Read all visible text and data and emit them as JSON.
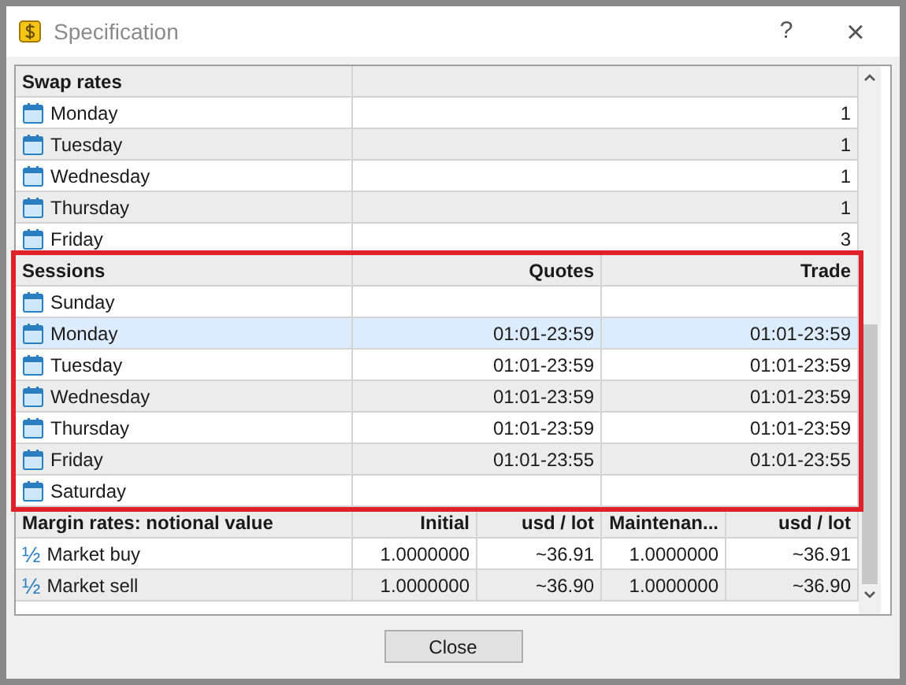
{
  "window": {
    "title": "Specification",
    "help": "?",
    "close": "×"
  },
  "swap": {
    "title": "Swap rates",
    "rows": [
      {
        "label": "Monday",
        "value": "1"
      },
      {
        "label": "Tuesday",
        "value": "1"
      },
      {
        "label": "Wednesday",
        "value": "1"
      },
      {
        "label": "Thursday",
        "value": "1"
      },
      {
        "label": "Friday",
        "value": "3"
      }
    ]
  },
  "sessions": {
    "title": "Sessions",
    "highlighted": true,
    "columns": [
      "Quotes",
      "Trade"
    ],
    "rows": [
      {
        "label": "Sunday",
        "quotes": "",
        "trade": "",
        "selected": false
      },
      {
        "label": "Monday",
        "quotes": "01:01-23:59",
        "trade": "01:01-23:59",
        "selected": true
      },
      {
        "label": "Tuesday",
        "quotes": "01:01-23:59",
        "trade": "01:01-23:59",
        "selected": false
      },
      {
        "label": "Wednesday",
        "quotes": "01:01-23:59",
        "trade": "01:01-23:59",
        "selected": false
      },
      {
        "label": "Thursday",
        "quotes": "01:01-23:59",
        "trade": "01:01-23:59",
        "selected": false
      },
      {
        "label": "Friday",
        "quotes": "01:01-23:55",
        "trade": "01:01-23:55",
        "selected": false
      },
      {
        "label": "Saturday",
        "quotes": "",
        "trade": "",
        "selected": false
      }
    ]
  },
  "margin": {
    "title": "Margin rates: notional value",
    "columns": [
      "Initial",
      "usd / lot",
      "Maintenan...",
      "usd / lot"
    ],
    "rows": [
      {
        "icon": "½",
        "label": "Market buy",
        "values": [
          "1.0000000",
          "~36.91",
          "1.0000000",
          "~36.91"
        ]
      },
      {
        "icon": "½",
        "label": "Market sell",
        "values": [
          "1.0000000",
          "~36.90",
          "1.0000000",
          "~36.90"
        ]
      }
    ]
  },
  "buttons": [
    "Close"
  ]
}
